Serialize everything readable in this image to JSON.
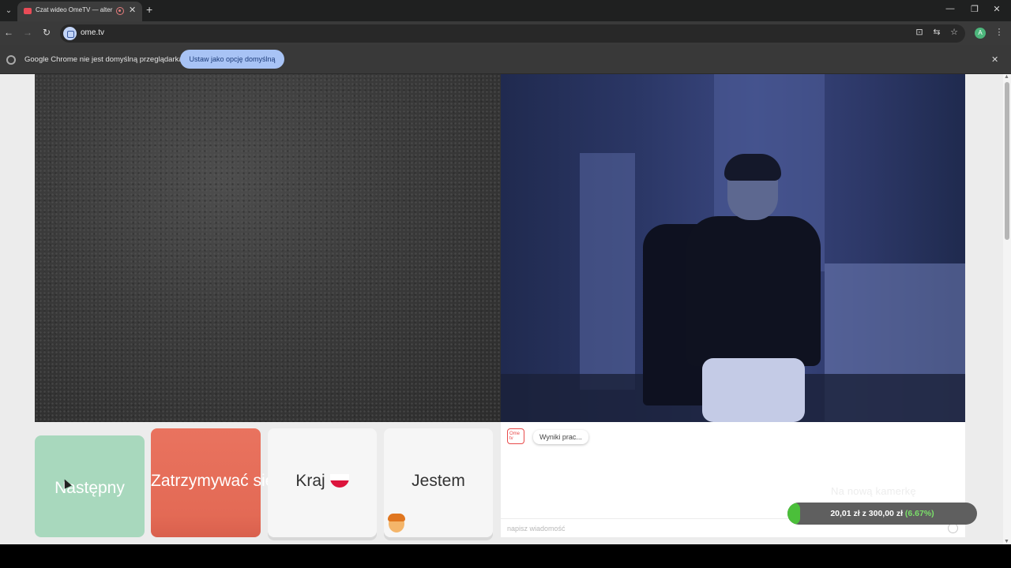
{
  "browser": {
    "tab_title": "Czat wideo OmeTV — alter",
    "url": "ome.tv",
    "info_text": "Google Chrome nie jest domyślną przeglądarką",
    "set_default_label": "Ustaw jako opcję domyślną",
    "profile_initial": "A"
  },
  "controls": {
    "next_label": "Następny",
    "stop_label": "Zatrzymywać się",
    "country_label": "Kraj",
    "me_label": "Jestem"
  },
  "chat": {
    "logo_text": "Ome tv",
    "status_message": "Wyniki prac...",
    "input_placeholder": "napisz wiadomość"
  },
  "overlay": {
    "title": "Na nową kamerkę",
    "raised": "20,01 zł",
    "separator": "z",
    "goal": "300,00 zł",
    "percent_text": "(6.67%)",
    "progress_fraction": 0.0667
  },
  "colors": {
    "next_button": "#a8d8bd",
    "stop_button": "#e36a55",
    "progress_fill": "#4bbf3a"
  },
  "icons": [
    "tab-menu-icon",
    "close-icon",
    "plus-icon",
    "minimize-icon",
    "restore-icon",
    "back-icon",
    "forward-icon",
    "reload-icon",
    "install-icon",
    "translate-icon",
    "star-icon",
    "kebab-menu-icon",
    "poland-flag-icon",
    "person-emoji-icon",
    "emoji-icon"
  ]
}
